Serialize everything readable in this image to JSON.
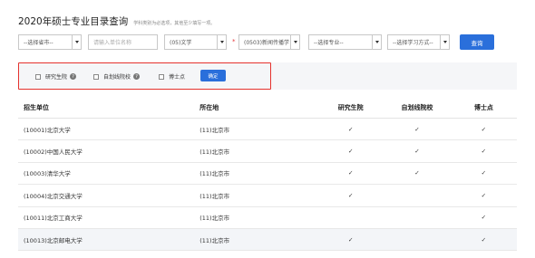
{
  "page": {
    "title": "2020年硕士专业目录查询",
    "hint": "学科类别为必选项，其他至少填写一项。"
  },
  "filters": {
    "province": "--选择省市--",
    "unit_placeholder": "请输入单位名称",
    "category": "(05)文学",
    "discipline": "(0503)新闻传播学",
    "major": "--选择专业--",
    "study_mode": "--选择学习方式--",
    "search_label": "查询"
  },
  "options": {
    "graduate_school": "研究生院",
    "self_drawn": "自划线院校",
    "doctoral": "博士点",
    "confirm_label": "确定",
    "help_glyph": "?"
  },
  "table": {
    "headers": [
      "招生单位",
      "所在地",
      "研究生院",
      "自划线院校",
      "博士点"
    ],
    "rows": [
      {
        "unit": "(10001)北京大学",
        "location": "(11)北京市",
        "grad": "✓",
        "self": "✓",
        "phd": "✓"
      },
      {
        "unit": "(10002)中国人民大学",
        "location": "(11)北京市",
        "grad": "✓",
        "self": "✓",
        "phd": "✓"
      },
      {
        "unit": "(10003)清华大学",
        "location": "(11)北京市",
        "grad": "✓",
        "self": "✓",
        "phd": "✓"
      },
      {
        "unit": "(10004)北京交通大学",
        "location": "(11)北京市",
        "grad": "✓",
        "self": "",
        "phd": "✓"
      },
      {
        "unit": "(10011)北京工商大学",
        "location": "(11)北京市",
        "grad": "",
        "self": "",
        "phd": "✓"
      },
      {
        "unit": "(10013)北京邮电大学",
        "location": "(11)北京市",
        "grad": "✓",
        "self": "",
        "phd": "✓"
      }
    ]
  },
  "colors": {
    "accent": "#2a6fdb",
    "highlight_border": "#e5322d"
  }
}
